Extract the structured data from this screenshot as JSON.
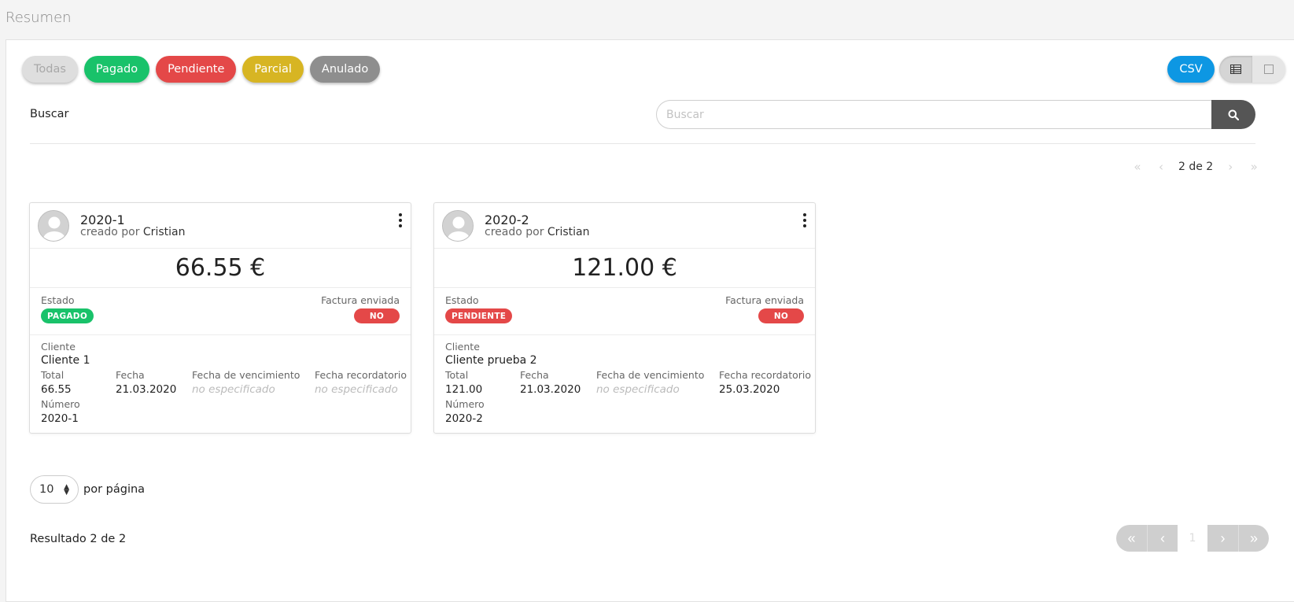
{
  "page": {
    "title": "Resumen"
  },
  "filters": [
    {
      "label": "Todas",
      "key": "todas"
    },
    {
      "label": "Pagado",
      "key": "pagado"
    },
    {
      "label": "Pendiente",
      "key": "pendiente"
    },
    {
      "label": "Parcial",
      "key": "parcial"
    },
    {
      "label": "Anulado",
      "key": "anulado"
    }
  ],
  "toolbar": {
    "csv_label": "CSV",
    "view_table_icon": "table-icon",
    "view_card_icon": "square-icon"
  },
  "search": {
    "label": "Buscar",
    "placeholder": "Buscar",
    "value": "",
    "button_icon": "search-icon"
  },
  "pager_top": {
    "info": "2 de 2"
  },
  "cards": [
    {
      "id": "2020-1",
      "created_by_prefix": "creado por",
      "created_by": "Cristian",
      "amount": "66.55 €",
      "status_label": "Estado",
      "status": "PAGADO",
      "status_color": "#19c26a",
      "invoice_label": "Factura enviada",
      "invoice_sent": "NO",
      "client_label": "Cliente",
      "client": "Cliente 1",
      "total_label": "Total",
      "total": "66.55",
      "date_label": "Fecha",
      "date": "21.03.2020",
      "due_label": "Fecha de vencimiento",
      "due": "no especificado",
      "reminder_label": "Fecha recordatorio",
      "reminder": "no especificado",
      "number_label": "Número",
      "number": "2020-1"
    },
    {
      "id": "2020-2",
      "created_by_prefix": "creado por",
      "created_by": "Cristian",
      "amount": "121.00 €",
      "status_label": "Estado",
      "status": "PENDIENTE",
      "status_color": "#e44848",
      "invoice_label": "Factura enviada",
      "invoice_sent": "NO",
      "client_label": "Cliente",
      "client": "Cliente prueba 2",
      "total_label": "Total",
      "total": "121.00",
      "date_label": "Fecha",
      "date": "21.03.2020",
      "due_label": "Fecha de vencimiento",
      "due": "no especificado",
      "reminder_label": "Fecha recordatorio",
      "reminder": "25.03.2020",
      "number_label": "Número",
      "number": "2020-2"
    }
  ],
  "per_page": {
    "value": "10",
    "label": "por página"
  },
  "result": {
    "text": "Resultado 2 de 2"
  },
  "pager_bottom": {
    "current": "1"
  },
  "colors": {
    "accent": "#0d97e3",
    "paid": "#19c26a",
    "pending": "#e44848",
    "partial": "#d7b523",
    "void": "#8e8e8e"
  }
}
